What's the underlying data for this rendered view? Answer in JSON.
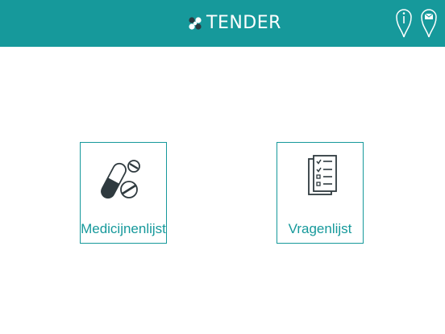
{
  "header": {
    "app_name": "TENDER",
    "background_color": "#16999b",
    "logo_icon": "tender-logo-icon",
    "actions": [
      {
        "name": "info",
        "icon": "info-icon"
      },
      {
        "name": "mail",
        "icon": "mail-icon"
      }
    ]
  },
  "menu": {
    "tiles": [
      {
        "label": "Medicijnenlijst",
        "icon": "pills-icon"
      },
      {
        "label": "Vragenlijst",
        "icon": "checklist-icon"
      }
    ],
    "accent_color": "#16999b"
  }
}
